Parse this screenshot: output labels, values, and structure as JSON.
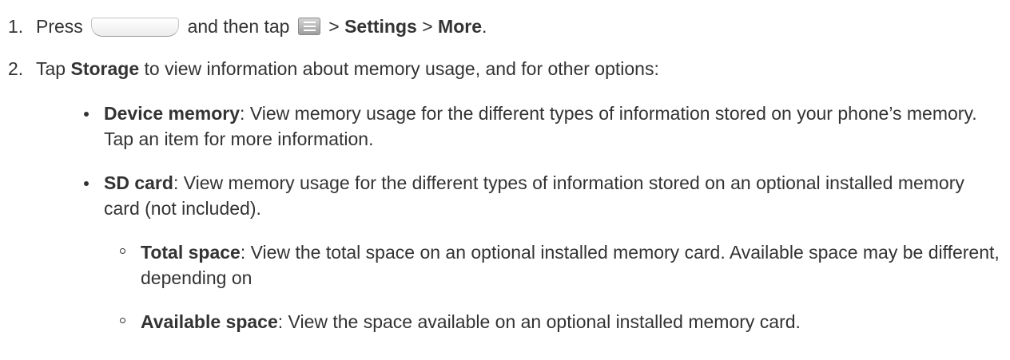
{
  "step1": {
    "number": "1.",
    "press": "Press",
    "and_then_tap": "and then tap",
    "sep1": ">",
    "settings": "Settings",
    "sep2": ">",
    "more": "More",
    "period": ".",
    "home_button_icon": "home-button",
    "menu_key_icon": "menu-key"
  },
  "step2": {
    "number": "2.",
    "tap": "Tap",
    "storage": "Storage",
    "rest": "to view information about memory usage, and for other options:"
  },
  "bullets": [
    {
      "term": "Device memory",
      "text": ": View memory usage for the different types of information stored on your phone’s memory. Tap an item for more information."
    },
    {
      "term": "SD card",
      "text": ": View memory usage for the different types of information stored on an optional installed memory card (not included)."
    }
  ],
  "sub_bullets": [
    {
      "term": "Total space",
      "text": ": View the total space on an optional installed memory card. Available space may be different, depending on"
    },
    {
      "term": "Available space",
      "text": ": View the space available on an optional installed memory card."
    }
  ]
}
